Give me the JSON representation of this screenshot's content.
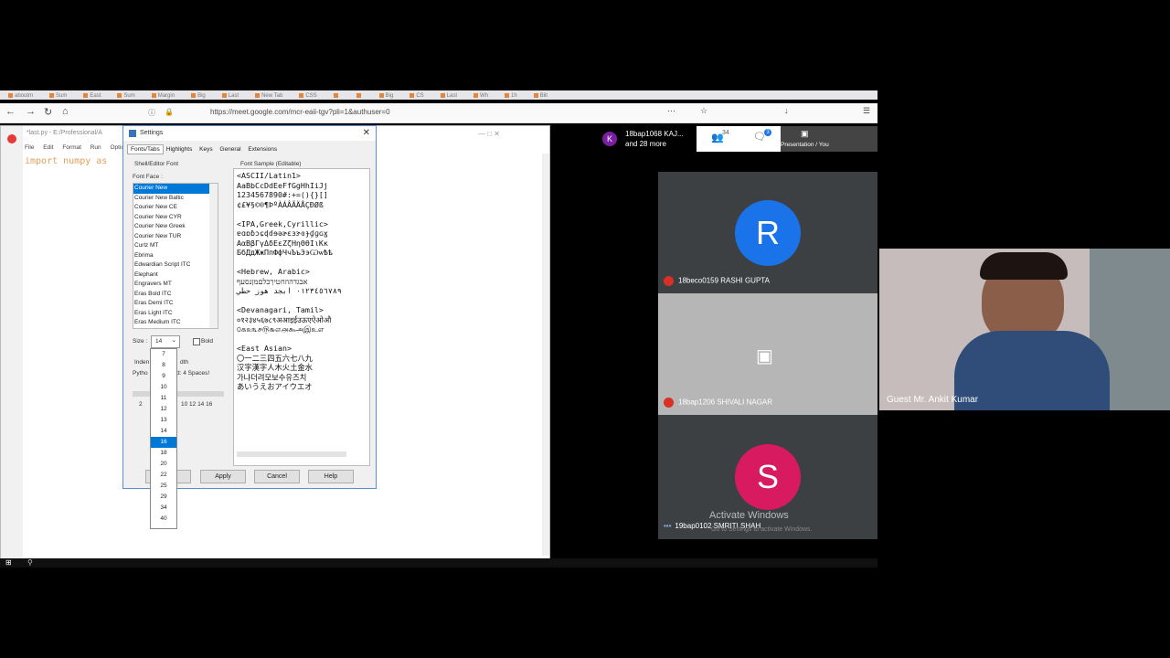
{
  "browser": {
    "tabs": [
      "aboutm",
      "Sum",
      "East",
      "Sum",
      "Margin",
      "Big",
      "Last",
      "New Tab",
      "CSS",
      "",
      "",
      "Big",
      "CS",
      "Last",
      "Wh",
      "1h",
      "Blit"
    ],
    "url": "https://meet.google.com/mcr-eaii-tgv?pli=1&authuser=0",
    "window_controls": "—  □  ✕"
  },
  "editor": {
    "title": "*last.py - E:/Professional/A",
    "menus": [
      "File",
      "Edit",
      "Format",
      "Run",
      "Optio"
    ],
    "code": "import numpy as"
  },
  "settings": {
    "title": "Settings",
    "tabs": [
      "Fonts/Tabs",
      "Highlights",
      "Keys",
      "General",
      "Extensions"
    ],
    "section": "Shell/Editor Font",
    "font_face_label": "Font Face :",
    "fonts": [
      "Courier New",
      "Courier New Baltic",
      "Courier New CE",
      "Courier New CYR",
      "Courier New Greek",
      "Courier New TUR",
      "Curlz MT",
      "Ebrima",
      "Edwardian Script ITC",
      "Elephant",
      "Engravers MT",
      "Eras Bold ITC",
      "Eras Demi ITC",
      "Eras Light ITC",
      "Eras Medium ITC"
    ],
    "selected_font": "Courier New",
    "sample_label": "Font Sample (Editable)",
    "sample_text": "<ASCII/Latin1>\nAaBbCcDdEeFfGgHhIiJj\n1234567890#:+=(){}[]\n¢£¥§©®¶ÞºÀÁÂÃÄÅÇÐØß\n\n<IPA,Greek,Cyrillic>\nɐɑɒɓɔɕɖɗɘəɚɛɜɝɞɟɠɡɢɣ\nΑαΒβΓγΔδΕεΖζΗηΘθΙιΚκ\nБбДдЖжПпФфЧчЪъЭэѠѡѢѣ\n\n<Hebrew, Arabic>\nאבגדהוזחטיךכלםמןנסעף\n٠١٢٣٤٥٦٧٨٩ ابجد هوز حطي\n\n<Devanagari, Tamil>\n०१२३४५६७८९अआइईउऊएऐओऔ\n௦௧௨௩௪௫௬௭௮௯அஇஉஎ\n\n<East Asian>\n〇一二三四五六七八九\n汉字漢字人木火土金水\n가냐더려모보수유즈치\nあいうえおアイウエオ",
    "size_label": "Size :",
    "size_value": "14",
    "bold_label": "Bold",
    "indent_label": "Inden",
    "indent_label2": "dth",
    "python_label": "Pytho",
    "spaces_label": "d: 4 Spaces!",
    "scale_ticks": "2",
    "scale_ticks2": "10  12  14  16",
    "size_options": [
      "7",
      "8",
      "9",
      "10",
      "11",
      "12",
      "13",
      "14",
      "16",
      "18",
      "20",
      "22",
      "25",
      "29",
      "34",
      "40"
    ],
    "selected_size": "16",
    "buttons": {
      "apply": "Apply",
      "cancel": "Cancel",
      "help": "Help"
    }
  },
  "meet": {
    "participants_chip": "18bap1068 KAJ...",
    "participants_more": "and 28 more",
    "people_count": "34",
    "chat_badge": "3",
    "presentation_label": "Presentation / You",
    "tiles": [
      {
        "initial": "R",
        "name": "18beco0159 RASHI GUPTA",
        "color": "#1a73e8"
      },
      {
        "initial": "",
        "name": "18bap1206 SHIVALI NAGAR",
        "color": "#b0b0b0"
      },
      {
        "initial": "S",
        "name": "19bap0102 SMRITI SHAH",
        "color": "#d81b60"
      }
    ],
    "activate_windows": "Activate Windows",
    "activate_windows_sub": "Go to Settings to activate Windows.",
    "guest_name": "Guest Mr. Ankit Kumar"
  }
}
